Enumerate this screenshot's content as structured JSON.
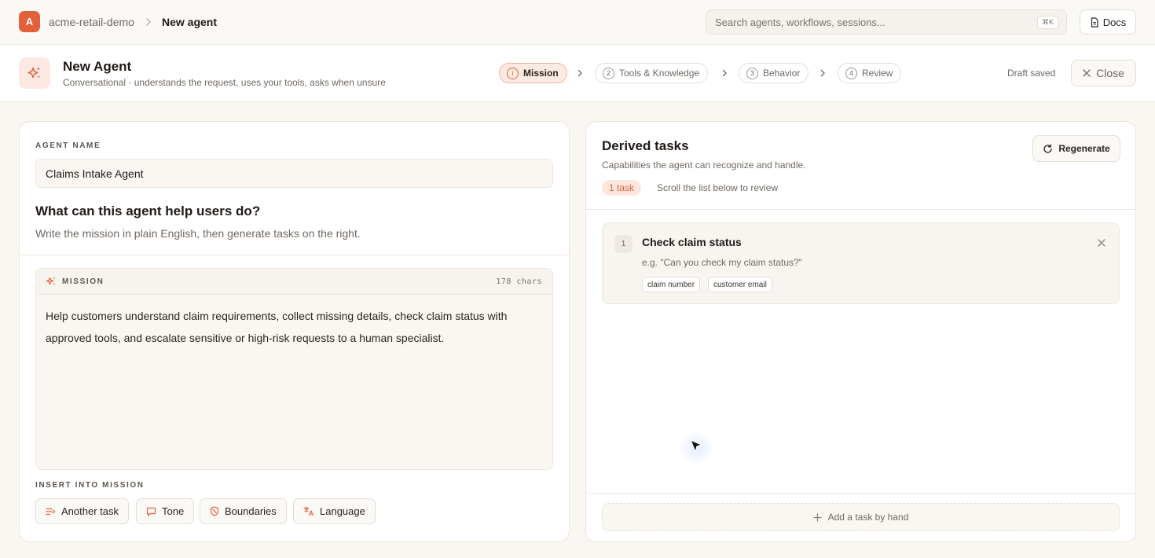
{
  "topbar": {
    "org_initial": "A",
    "org_name": "acme-retail-demo",
    "page": "New agent",
    "search_placeholder": "Search agents, workflows, sessions...",
    "search_shortcut": "⌘K",
    "docs_label": "Docs"
  },
  "agent_header": {
    "title": "New Agent",
    "subtitle": "Conversational · understands the request, uses your tools, asks when unsure",
    "steps": [
      {
        "num": "1",
        "label": "Mission",
        "active": true
      },
      {
        "num": "2",
        "label": "Tools & Knowledge",
        "active": false
      },
      {
        "num": "3",
        "label": "Behavior",
        "active": false
      },
      {
        "num": "4",
        "label": "Review",
        "active": false
      }
    ],
    "draft_status": "Draft saved",
    "close_label": "Close"
  },
  "left_panel": {
    "agent_name_label": "AGENT NAME",
    "agent_name_value": "Claims Intake Agent",
    "question_title": "What can this agent help users do?",
    "question_subtitle": "Write the mission in plain English, then generate tasks on the right.",
    "mission_label": "MISSION",
    "mission_chars": "178 chars",
    "mission_text": "Help customers understand claim requirements, collect missing details, check claim status with approved tools, and escalate sensitive or high-risk requests to a human specialist.",
    "insert_label": "INSERT INTO MISSION",
    "insert_chips": [
      {
        "label": "Another task",
        "icon": "list-add-icon"
      },
      {
        "label": "Tone",
        "icon": "message-icon"
      },
      {
        "label": "Boundaries",
        "icon": "shield-icon"
      },
      {
        "label": "Language",
        "icon": "translate-icon"
      }
    ]
  },
  "right_panel": {
    "title": "Derived tasks",
    "subtitle": "Capabilities the agent can recognize and handle.",
    "regenerate_label": "Regenerate",
    "task_count": "1 task",
    "scroll_hint": "Scroll the list below to review",
    "tasks": [
      {
        "num": "1",
        "title": "Check claim status",
        "example": "e.g. \"Can you check my claim status?\"",
        "tags": [
          "claim number",
          "customer email"
        ]
      }
    ],
    "add_task_label": "Add a task by hand"
  },
  "colors": {
    "accent": "#e2603a",
    "background": "#faf7f3",
    "panel": "#ffffff"
  }
}
